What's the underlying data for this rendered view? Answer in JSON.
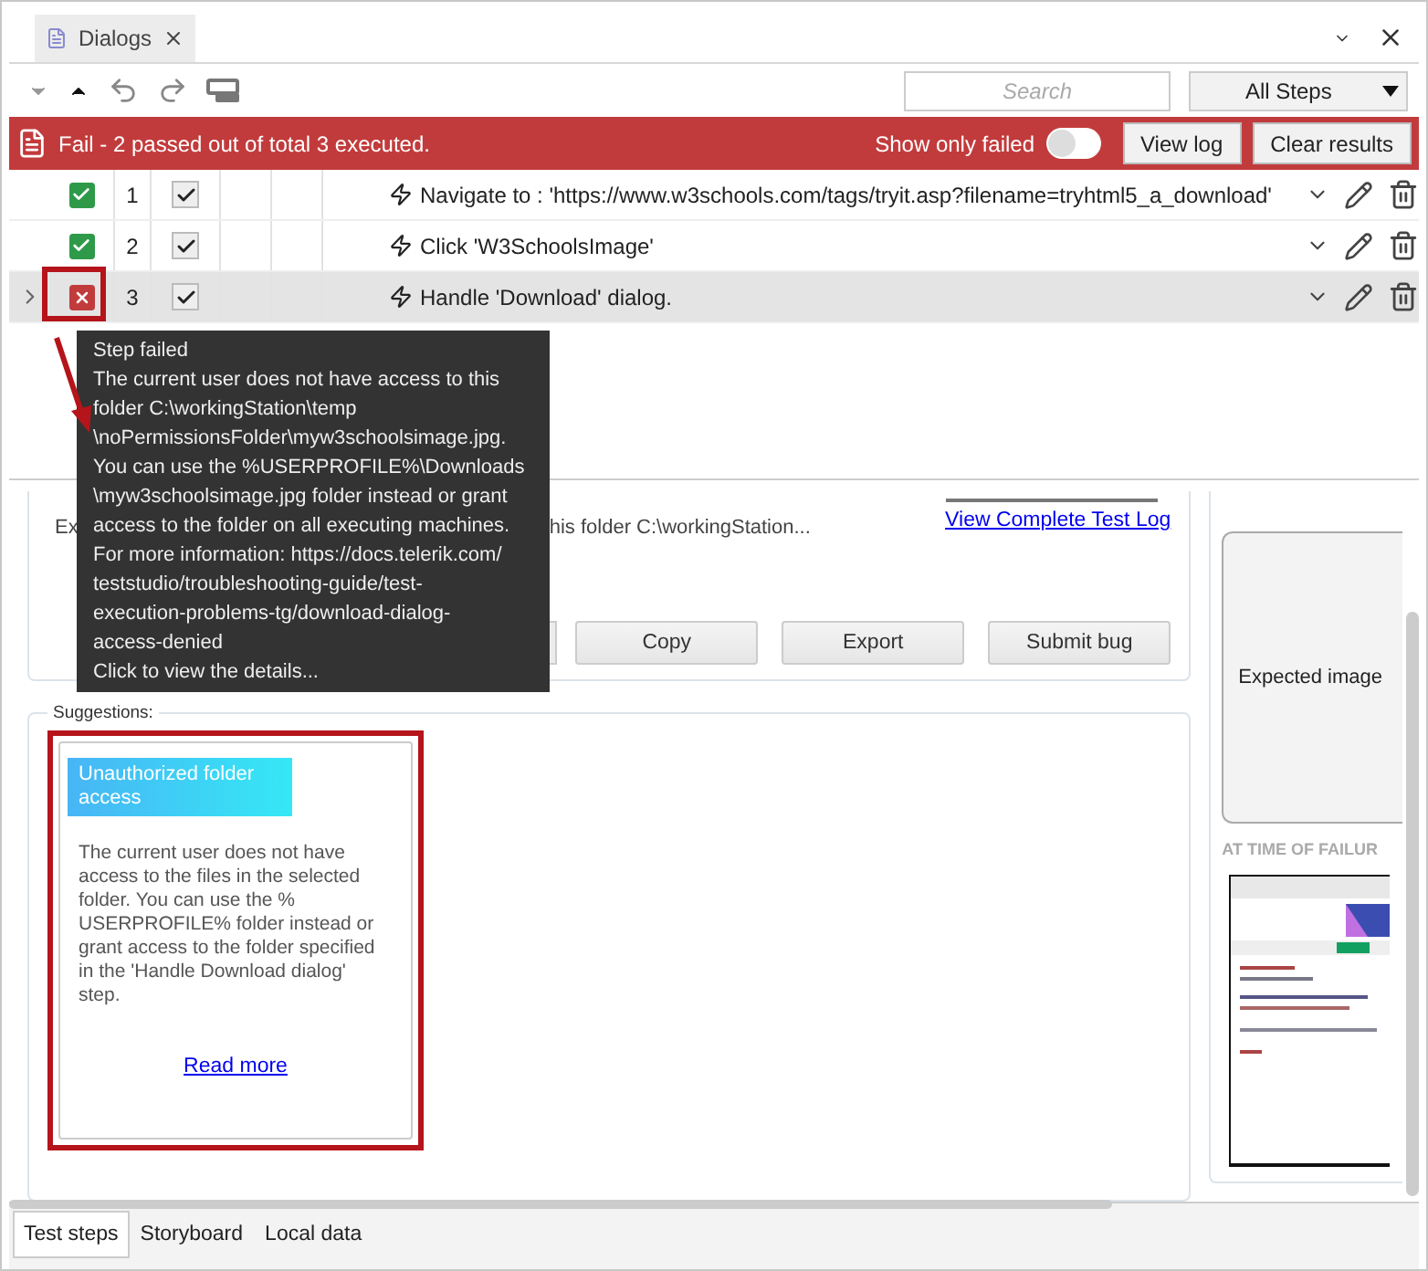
{
  "tab": {
    "title": "Dialogs"
  },
  "toolbar": {
    "search_placeholder": "Search",
    "filter": "All Steps"
  },
  "status": {
    "message": "Fail - 2 passed out of total 3 executed.",
    "filter_label": "Show only failed",
    "filter_on": false,
    "buttons": [
      "View log",
      "Clear results"
    ]
  },
  "steps": [
    {
      "number": "1",
      "passed": true,
      "enabled": true,
      "selected": false,
      "text": "Navigate to : 'https://www.w3schools.com/tags/tryit.asp?filename=tryhtml5_a_download'"
    },
    {
      "number": "2",
      "passed": true,
      "enabled": true,
      "selected": false,
      "text": "Click 'W3SchoolsImage'"
    },
    {
      "number": "3",
      "passed": false,
      "enabled": true,
      "selected": true,
      "text": "Handle 'Download' dialog."
    }
  ],
  "tooltip": {
    "title": "Step failed",
    "lines": [
      "The current user does not have access to this",
      "folder C:\\workingStation\\temp",
      "\\noPermissionsFolder\\myw3schoolsimage.jpg.",
      "You can use the %USERPROFILE%\\Downloads",
      "\\myw3schoolsimage.jpg folder instead or grant",
      "access to the folder on all executing machines.",
      "For more information: https://docs.telerik.com/",
      "teststudio/troubleshooting-guide/test-",
      "execution-problems-tg/download-dialog-",
      "access-denied",
      "Click to view the details..."
    ]
  },
  "error_panel": {
    "text_start": "Ex",
    "text_end": "his folder C:\\workingStation...",
    "link": "View Complete Test Log",
    "buttons": [
      "Copy",
      "Export",
      "Submit bug"
    ]
  },
  "suggestions": {
    "label": "Suggestions:",
    "cards": [
      {
        "title": "Unauthorized folder access",
        "text": "The current user does not have access to the files in the selected folder. You can use the % USERPROFILE% folder instead or grant access to the folder specified in the 'Handle Download dialog' step.",
        "link": "Read more",
        "highlighted": true
      }
    ]
  },
  "comparison": {
    "expected": "Expected image",
    "failure_heading": "AT TIME OF FAILUR"
  },
  "bottom_tabs": [
    {
      "label": "Test steps",
      "selected": true
    },
    {
      "label": "Storyboard",
      "selected": false
    },
    {
      "label": "Local data",
      "selected": false
    }
  ]
}
